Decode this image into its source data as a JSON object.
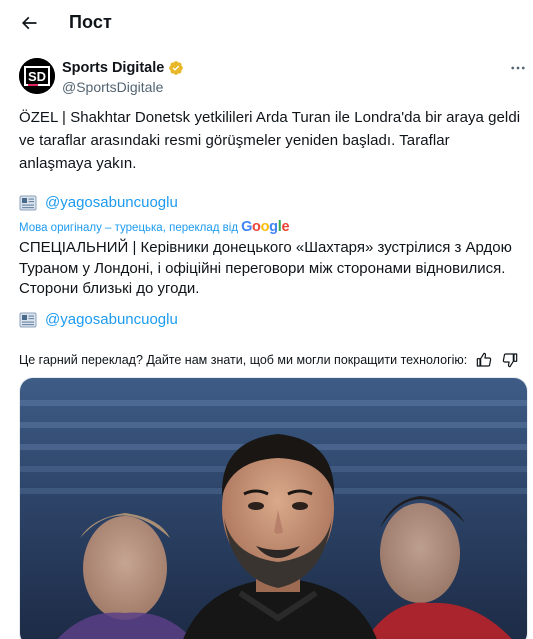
{
  "header": {
    "title": "Пост"
  },
  "author": {
    "name": "Sports Digitale",
    "handle": "@SportsDigitale",
    "avatar_text": "SD"
  },
  "tweet": {
    "text": "ÖZEL | Shakhtar Donetsk yetkilileri Arda Turan ile Londra'da bir araya geldi ve taraflar arasındaki resmi görüşmeler yeniden başladı. Taraflar anlaşmaya yakın.",
    "mention": "@yagosabuncuoglu"
  },
  "translation": {
    "note": "Мова оригіналу – турецька, переклад від",
    "provider": "Google",
    "text": "СПЕЦІАЛЬНИЙ | Керівники донецького «Шахтаря» зустрілися з Ардою Тураном у Лондоні, і офіційні переговори між сторонами відновилися. Сторони близькі до угоди.",
    "mention": "@yagosabuncuoglu"
  },
  "feedback": {
    "question": "Це гарний переклад? Дайте нам знати, щоб ми могли покращити технологію:"
  },
  "colors": {
    "link": "#1d9bf0",
    "verified": "#e8b829",
    "secondary_text": "#536471"
  },
  "icons": {
    "back": "arrow-left-icon",
    "more": "more-horizontal-icon",
    "verified": "verified-badge-icon",
    "news": "newspaper-emoji-icon",
    "like_feedback": "thumbs-up-icon",
    "dislike_feedback": "thumbs-down-icon"
  }
}
